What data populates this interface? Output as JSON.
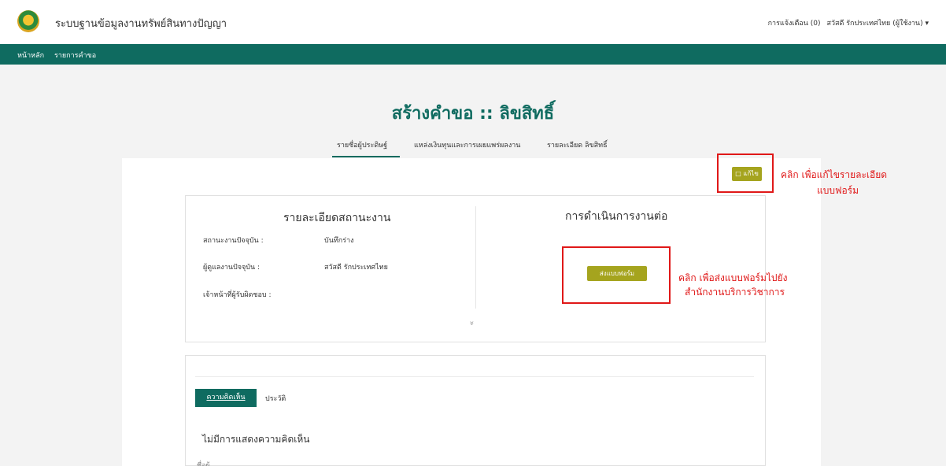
{
  "header": {
    "app_title": "ระบบฐานข้อมูลงานทรัพย์สินทางปัญญา",
    "notifications": "การแจ้งเตือน (0)",
    "user": "สวัสดี รักประเทศไทย (ผู้ใช้งาน)",
    "user_caret": "▾"
  },
  "nav": {
    "home": "หน้าหลัก",
    "requests": "รายการคำขอ"
  },
  "page": {
    "title": "สร้างคำขอ :: ลิขสิทธิ์"
  },
  "tabs": [
    {
      "label": "รายชื่อผู้ประดิษฐ์"
    },
    {
      "label": "แหล่งเงินทุนและการเผยแพร่ผลงาน"
    },
    {
      "label": "รายละเอียด ลิขสิทธิ์"
    }
  ],
  "actions": {
    "edit_label": "□ แก้ไข",
    "send_label": "ส่งแบบฟอร์ม"
  },
  "annotations": {
    "edit_note_line1": "คลิก เพื่อแก้ไขรายละเอียด",
    "edit_note_line2": "แบบฟอร์ม",
    "send_note_line1": "คลิก เพื่อส่งแบบฟอร์มไปยัง",
    "send_note_line2": "สำนักงานบริการวิชาการ"
  },
  "status": {
    "section_title": "รายละเอียดสถานะงาน",
    "current_status_label": "สถานะงานปัจจุบัน :",
    "current_status_value": "บันทึกร่าง",
    "current_owner_label": "ผู้ดูแลงานปัจจุบัน :",
    "current_owner_value": "สวัสดี รักประเทศไทย",
    "officer_label": "เจ้าหน้าที่ผู้รับผิดชอบ :"
  },
  "next": {
    "section_title": "การดำเนินการงานต่อ"
  },
  "expand_icon": "»",
  "comments": {
    "tab_comment": "ความคิดเห็น",
    "tab_history": "ประวัติ",
    "empty_text": "ไม่มีการแสดงความคิดเห็น",
    "cut_text": "ชื่อผู้ใช้"
  },
  "colors": {
    "primary": "#0f6b60",
    "button": "#a5a41e",
    "annotation": "#e01818"
  }
}
